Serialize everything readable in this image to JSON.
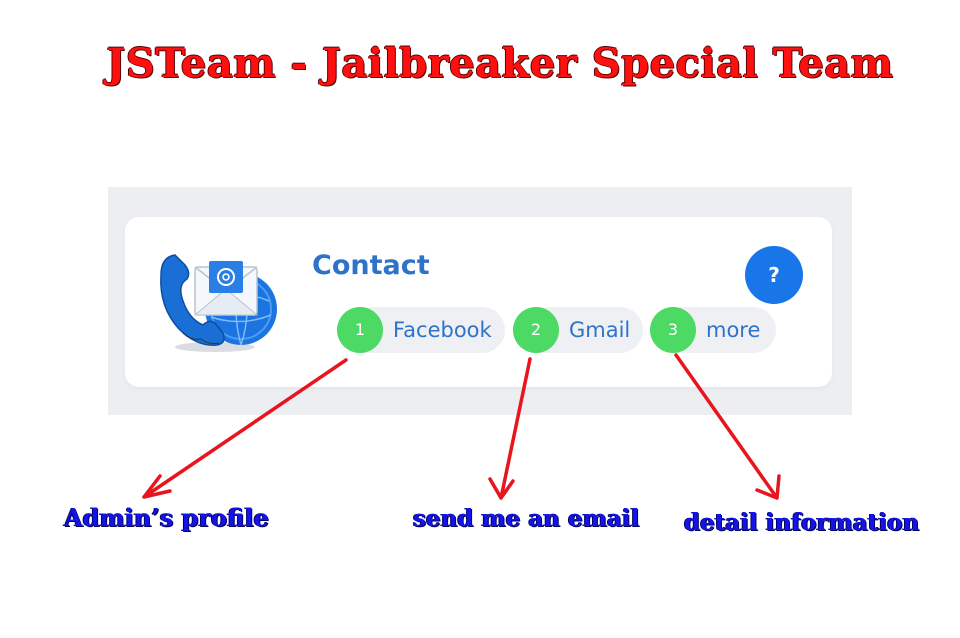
{
  "banner": {
    "title": "JSTeam - Jailbreaker Special Team"
  },
  "contact_card": {
    "title": "Contact",
    "help_label": "?",
    "illustration_icon": "phone-email-icon",
    "links": [
      {
        "number": "1",
        "label": "Facebook"
      },
      {
        "number": "2",
        "label": "Gmail"
      },
      {
        "number": "3",
        "label": "more"
      }
    ]
  },
  "annotations": [
    {
      "text": "Admin’s profile",
      "target": "Facebook"
    },
    {
      "text": "send me an email",
      "target": "Gmail"
    },
    {
      "text": "detail information",
      "target": "more"
    }
  ],
  "colors": {
    "banner_text": "#ff1010",
    "annotation_text": "#1414e6",
    "arrow": "#e8141e",
    "accent_blue": "#1976e8",
    "badge_green": "#4cd964",
    "link_text": "#2f73c9",
    "frame_bg": "#eceef2",
    "pill_bg": "#eef0f3"
  }
}
